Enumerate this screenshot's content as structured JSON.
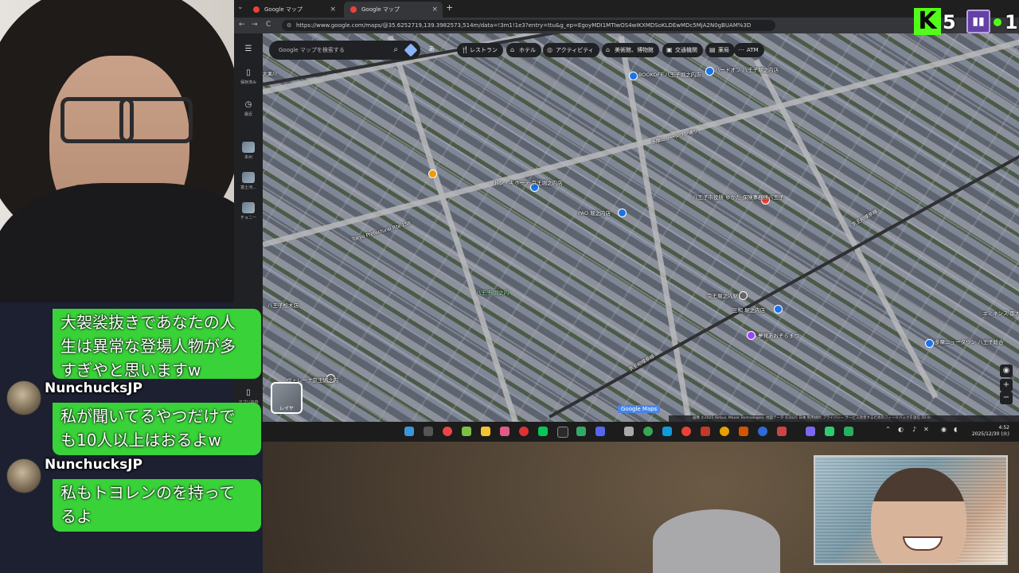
{
  "browser": {
    "tabs": [
      {
        "title": "Google マップ",
        "close": "×"
      },
      {
        "title": "Google マップ",
        "close": "×"
      }
    ],
    "new_tab": "+",
    "nav": {
      "back": "←",
      "forward": "→",
      "reload": "C"
    },
    "url": "https://www.google.com/maps/@35.6252719,139.3982573,514m/data=!3m1!1e3?entry=ttu&g_ep=EgoyMDI1MTIwOS4wIKXMDSoKLDEwMDc5MjA2N0gBUAM%3D"
  },
  "maps_rail": {
    "items": [
      {
        "label": "保存済み",
        "icon": "bookmark-icon"
      },
      {
        "label": "最近",
        "icon": "history-icon"
      },
      {
        "label": "本州",
        "icon": "thumbnail"
      },
      {
        "label": "富士河...",
        "icon": "thumbnail"
      },
      {
        "label": "チョニー",
        "icon": "thumbnail"
      },
      {
        "label": "アプリ内容",
        "icon": "phone-icon"
      }
    ],
    "menu_icon": "☰"
  },
  "search": {
    "placeholder": "Google マップを検索する"
  },
  "ime_indicator": "あ",
  "chips": [
    {
      "label": "レストラン",
      "icon": "🍴"
    },
    {
      "label": "ホテル",
      "icon": "⌂"
    },
    {
      "label": "アクティビティ",
      "icon": "◎"
    },
    {
      "label": "美術館、博物館",
      "icon": "⌂"
    },
    {
      "label": "交通機関",
      "icon": "▣"
    },
    {
      "label": "薬局",
      "icon": "▤"
    },
    {
      "label": "ATM",
      "icon": "⋯"
    }
  ],
  "map_labels": {
    "places": [
      "BOOKOFF 八王子堀之内店",
      "ハードオフ 八王子堀之内店",
      "ドン・キホーテ 京王堀之内店",
      "PAO 堀之内店",
      "八王子市役所 ゆかた 保険事務所八王子",
      "京王堀之内駅",
      "三和 堀之内店",
      "八王子松木店",
      "ヴェレーナ京王堀之内",
      "多摩ニュータウン 八王子総合",
      "エミネンス 南大沢",
      "八王子 堀之内",
      "夢見あおぞらまつ"
    ],
    "roads": [
      "大栗川",
      "多摩ニュータウン通り",
      "Tokyo Prefectural Rte 158",
      "京王相模原線",
      "京王相模原線"
    ]
  },
  "layer_button": "レイヤ",
  "map_controls": {
    "locate": "◉",
    "zoom_in": "+",
    "zoom_out": "−"
  },
  "map_footer": "画像 ©2025 Airbus, Maxar Technologies, 地図データ ©2025  日本  利用規約  プライバシー  サービス改善するためのフィードバックを送信  50 m",
  "google_logo": "Google Maps",
  "taskbar": {
    "time": "4:52",
    "date": "2025/12/30 (火)"
  },
  "overlay_stats": {
    "kick_logo": "K",
    "kick_viewers": "5",
    "twitch_viewers": "1",
    "twitch_logo": "▮▮"
  },
  "chat_messages": [
    {
      "user": "",
      "text": "大袈裟抜きであなたの人生は異常な登場人物が多すぎやと思いますw",
      "lines": [
        "大袈裟抜きであなたの人",
        "生は異常な登場人物が多",
        "すぎやと思いますw"
      ]
    },
    {
      "user": "NunchucksJP",
      "text": "私が聞いてるやつだけでも10人以上はおるよw",
      "lines": [
        "私が聞いてるやつだけで",
        "も10人以上はおるよw"
      ]
    },
    {
      "user": "NunchucksJP",
      "text": "私もトヨレンのを持ってるよ",
      "lines": [
        "私もトヨレンのを持って",
        "るよ"
      ]
    }
  ],
  "colors": {
    "kick_green": "#53fc18",
    "twitch_purple": "#6441a5",
    "chat_green": "#39d239",
    "maps_blue": "#1a73e8"
  }
}
